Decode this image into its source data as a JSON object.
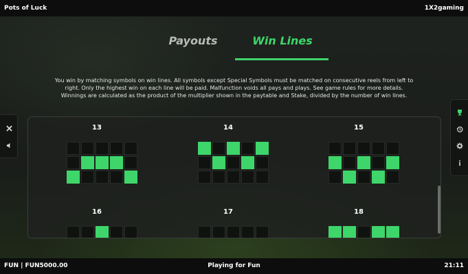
{
  "app": {
    "title": "Pots of Luck",
    "brand": "1X2gaming"
  },
  "tabs": [
    {
      "label": "Payouts",
      "active": false
    },
    {
      "label": "Win Lines",
      "active": true
    }
  ],
  "description": "You win by matching symbols on win lines. All symbols except Special Symbols must be matched on consecutive reels from left to right. Only the highest win on each line will be paid. Malfunction voids all pays and plays. See game rules for more details. Winnings are calculated as the product of the multiplier shown in the paytable and Stake, divided by the number of win lines.",
  "win_lines": [
    {
      "number": "13",
      "pattern": [
        [
          0,
          0,
          0,
          0,
          0
        ],
        [
          0,
          1,
          1,
          1,
          0
        ],
        [
          1,
          0,
          0,
          0,
          1
        ]
      ]
    },
    {
      "number": "14",
      "pattern": [
        [
          1,
          0,
          1,
          0,
          1
        ],
        [
          0,
          1,
          0,
          1,
          0
        ],
        [
          0,
          0,
          0,
          0,
          0
        ]
      ]
    },
    {
      "number": "15",
      "pattern": [
        [
          0,
          0,
          0,
          0,
          0
        ],
        [
          1,
          0,
          1,
          0,
          1
        ],
        [
          0,
          1,
          0,
          1,
          0
        ]
      ]
    },
    {
      "number": "16",
      "pattern": [
        [
          0,
          0,
          1,
          0,
          0
        ]
      ]
    },
    {
      "number": "17",
      "pattern": [
        [
          0,
          0,
          0,
          0,
          0
        ]
      ]
    },
    {
      "number": "18",
      "pattern": [
        [
          1,
          1,
          0,
          1,
          1
        ]
      ]
    }
  ],
  "left_controls": [
    {
      "icon": "close-icon"
    },
    {
      "icon": "sound-icon"
    }
  ],
  "right_controls": [
    {
      "icon": "trophy-icon"
    },
    {
      "icon": "history-icon"
    },
    {
      "icon": "gear-icon"
    },
    {
      "icon": "info-icon"
    }
  ],
  "status": {
    "balance": "FUN | FUN5000.00",
    "mode": "Playing for Fun",
    "time": "21:11"
  },
  "colors": {
    "accent": "#3ed66a",
    "cell_off": "#101210",
    "bar": "#0c0d0c"
  }
}
